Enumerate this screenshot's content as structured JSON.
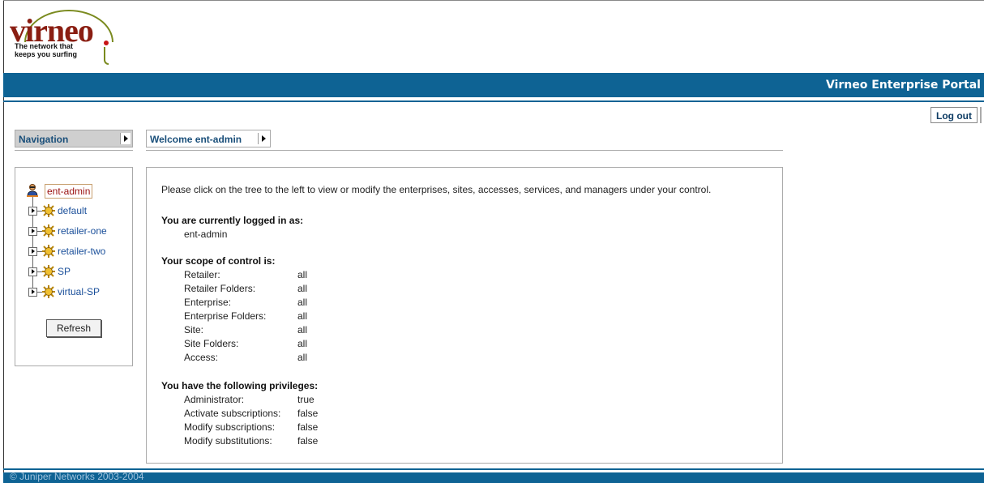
{
  "brand": {
    "logo_word": "virneo",
    "tagline": "The network that keeps you surfing"
  },
  "header": {
    "title": "Virneo Enterprise Portal",
    "logout_label": "Log out"
  },
  "navigation": {
    "title": "Navigation",
    "root": "ent-admin",
    "nodes": [
      {
        "label": "default"
      },
      {
        "label": "retailer-one"
      },
      {
        "label": "retailer-two"
      },
      {
        "label": "SP"
      },
      {
        "label": "virtual-SP"
      }
    ],
    "refresh_label": "Refresh"
  },
  "welcome": {
    "title": "Welcome ent-admin",
    "intro": "Please click on the tree to the left to view or modify the enterprises, sites, accesses, services, and managers under your control.",
    "logged_in_title": "You are currently logged in as:",
    "logged_in_value": "ent-admin",
    "scope_title": "Your scope of control is:",
    "scope": [
      {
        "key": "Retailer:",
        "value": "all"
      },
      {
        "key": "Retailer Folders:",
        "value": "all"
      },
      {
        "key": "Enterprise:",
        "value": "all"
      },
      {
        "key": "Enterprise Folders:",
        "value": "all"
      },
      {
        "key": "Site:",
        "value": "all"
      },
      {
        "key": "Site Folders:",
        "value": "all"
      },
      {
        "key": "Access:",
        "value": "all"
      }
    ],
    "privileges_title": "You have the following privileges:",
    "privileges": [
      {
        "key": "Administrator:",
        "value": "true"
      },
      {
        "key": "Activate subscriptions:",
        "value": "false"
      },
      {
        "key": "Modify subscriptions:",
        "value": "false"
      },
      {
        "key": "Modify substitutions:",
        "value": "false"
      }
    ]
  },
  "footer": {
    "copyright": "© Juniper Networks 2003-2004"
  },
  "colors": {
    "band": "#0e6394",
    "brand_red": "#8a1e12",
    "link_blue": "#1a4f9a"
  },
  "icons": {
    "user": "user-icon",
    "node": "gear-icon",
    "expand": "expand-arrow-icon"
  }
}
